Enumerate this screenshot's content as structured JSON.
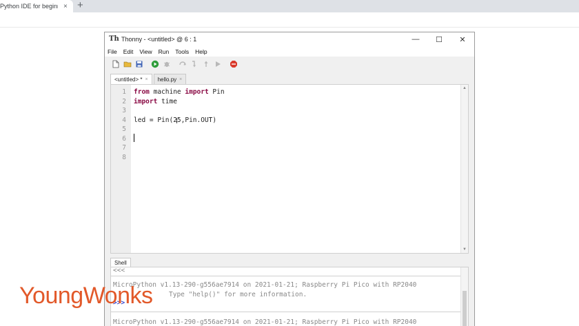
{
  "browser": {
    "tab_title": "Python IDE for beginners",
    "tab_close": "×",
    "new_tab": "+"
  },
  "window": {
    "title": "Thonny - <untitled> @ 6 : 1",
    "app_icon_text": "Th",
    "controls": {
      "minimize": "—",
      "maximize": "☐",
      "close": "✕"
    }
  },
  "menu": [
    "File",
    "Edit",
    "View",
    "Run",
    "Tools",
    "Help"
  ],
  "toolbar": {
    "buttons": [
      "new-file",
      "open-file",
      "save",
      "run",
      "debug",
      "step-over",
      "step-into",
      "step-out",
      "resume",
      "stop"
    ],
    "colors": {
      "run": "#2e9d3a",
      "stop": "#d93a2b",
      "disabled": "#b8b8b8"
    }
  },
  "editor_tabs": [
    {
      "label": "<untitled> *",
      "close": "×"
    },
    {
      "label": "hello.py",
      "close": "×"
    }
  ],
  "editor": {
    "line_numbers": [
      "1",
      "2",
      "3",
      "4",
      "5",
      "6",
      "7",
      "8"
    ],
    "lines": [
      {
        "kw1": "from",
        "mid": " machine ",
        "kw2": "import",
        "rest": " Pin"
      },
      {
        "kw1": "import",
        "mid": " time",
        "kw2": "",
        "rest": ""
      },
      {
        "kw1": "",
        "mid": "",
        "kw2": "",
        "rest": ""
      },
      {
        "kw1": "",
        "mid": "led = Pin(25,Pin.OUT)",
        "kw2": "",
        "rest": ""
      },
      {
        "kw1": "",
        "mid": "",
        "kw2": "",
        "rest": ""
      },
      {
        "kw1": "",
        "mid": "",
        "kw2": "",
        "rest": ""
      },
      {
        "kw1": "",
        "mid": "",
        "kw2": "",
        "rest": ""
      },
      {
        "kw1": "",
        "mid": "",
        "kw2": "",
        "rest": ""
      }
    ],
    "cursor": "I"
  },
  "shell": {
    "tab_label": "Shell",
    "partial_top": "<<<",
    "line1": "MicroPython v1.13-290-g556ae7914 on 2021-01-21; Raspberry Pi Pico with RP2040",
    "line2": "Type \"help()\" for more information.",
    "prompt": ">>>",
    "line3": "MicroPython v1.13-290-g556ae7914 on 2021-01-21; Raspberry Pi Pico with RP2040"
  },
  "watermark": "YoungWonks"
}
